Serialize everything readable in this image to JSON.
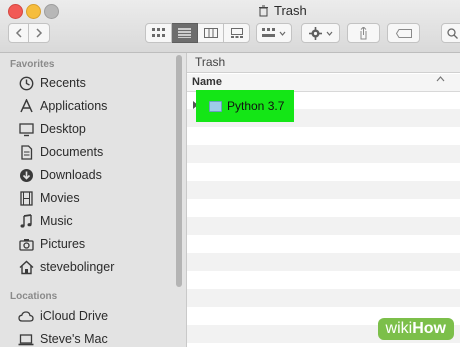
{
  "window": {
    "title": "Trash",
    "trash_icon": "trash-icon"
  },
  "toolbar": {
    "back_icon": "chevron-left-icon",
    "forward_icon": "chevron-right-icon",
    "view_icons": [
      "icon-view-icon",
      "list-view-icon",
      "column-view-icon",
      "gallery-view-icon"
    ],
    "active_view": "list-view-icon",
    "group_icon": "group-by-icon",
    "action_icon": "gear-icon",
    "share_icon": "share-icon",
    "tag_icon": "tag-icon",
    "search_icon": "search-icon"
  },
  "sidebar": {
    "favorites_header": "Favorites",
    "favorites": [
      {
        "label": "Recents",
        "icon": "clock-icon"
      },
      {
        "label": "Applications",
        "icon": "applications-icon"
      },
      {
        "label": "Desktop",
        "icon": "desktop-icon"
      },
      {
        "label": "Documents",
        "icon": "document-icon"
      },
      {
        "label": "Downloads",
        "icon": "download-icon"
      },
      {
        "label": "Movies",
        "icon": "film-icon"
      },
      {
        "label": "Music",
        "icon": "music-note-icon"
      },
      {
        "label": "Pictures",
        "icon": "camera-icon"
      },
      {
        "label": "stevebolinger",
        "icon": "home-icon"
      }
    ],
    "locations_header": "Locations",
    "locations": [
      {
        "label": "iCloud Drive",
        "icon": "cloud-icon"
      },
      {
        "label": "Steve's Mac",
        "icon": "laptop-icon"
      }
    ]
  },
  "main": {
    "path": "Trash",
    "column_header": "Name",
    "files": [
      {
        "label": "Python 3.7",
        "icon": "folder-icon",
        "highlighted": true,
        "highlight_color": "#14e616"
      }
    ]
  },
  "watermark": {
    "part1": "wiki",
    "part2": "How"
  }
}
